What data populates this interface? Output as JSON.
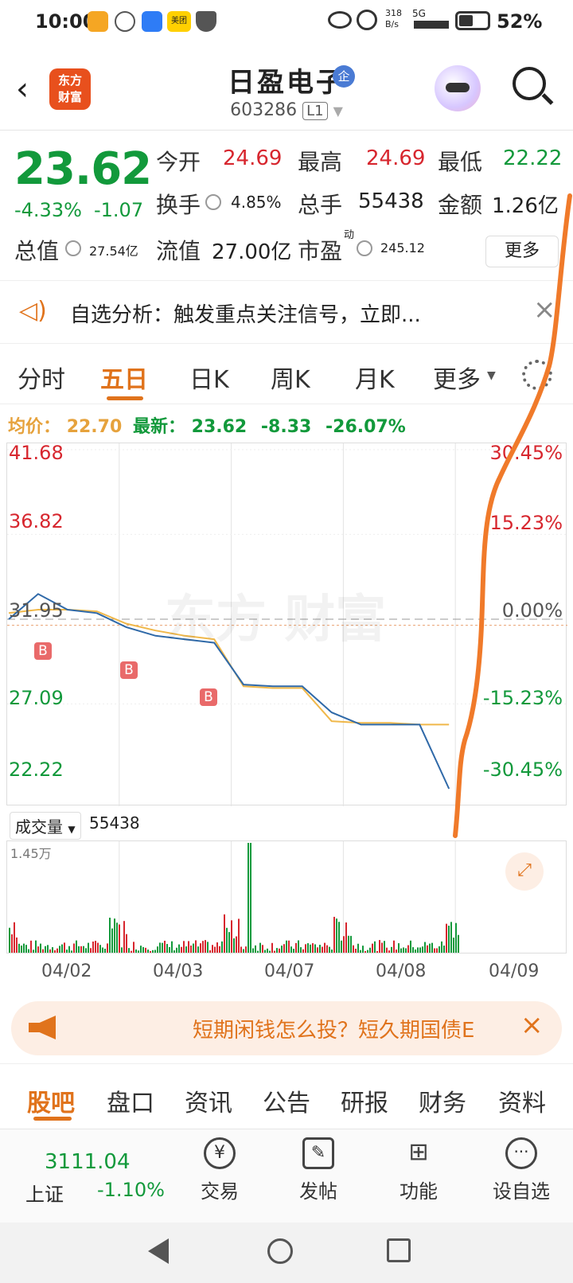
{
  "status_bar": {
    "time": "10:00",
    "speed": "318\nB/s",
    "network": "5G",
    "battery": "52%",
    "app_icon_label": "美团"
  },
  "header": {
    "logo_text": "东方\n财富",
    "title": "日盈电子",
    "badge": "企",
    "code": "603286",
    "level": "L1"
  },
  "quote": {
    "price": "23.62",
    "change_pct": "-4.33%",
    "change": "-1.07",
    "open_label": "今开",
    "open": "24.69",
    "high_label": "最高",
    "high": "24.69",
    "low_label": "最低",
    "low": "22.22",
    "turnover_label": "换手",
    "turnover": "4.85%",
    "volume_label": "总手",
    "volume": "55438",
    "amount_label": "金额",
    "amount": "1.26亿",
    "mktcap_label": "总值",
    "mktcap": "27.54亿",
    "float_label": "流值",
    "float_cap": "27.00亿",
    "pe_label": "市盈",
    "pe_sup": "动",
    "pe": "245.12",
    "more": "更多"
  },
  "notice": {
    "text": "自选分析：触发重点关注信号，立即..."
  },
  "tabs": [
    "分时",
    "五日",
    "日K",
    "周K",
    "月K",
    "更多"
  ],
  "avg_line": {
    "avg_label": "均价：",
    "avg": "22.70",
    "latest_label": "最新：",
    "latest": "23.62",
    "chg": "-8.33",
    "pct": "-26.07%"
  },
  "chart_data": {
    "type": "line",
    "title": "",
    "x": [
      "04/02",
      "04/03",
      "04/07",
      "04/08",
      "04/09"
    ],
    "y_left_ticks": [
      "41.68",
      "36.82",
      "31.95",
      "27.09",
      "22.22"
    ],
    "y_right_ticks": [
      "30.45%",
      "15.23%",
      "0.00%",
      "-15.23%",
      "-30.45%"
    ],
    "ylim": [
      22.22,
      41.68
    ],
    "series": [
      {
        "values": [
          31.95,
          33.4,
          32.5,
          32.3,
          31.5,
          31.0,
          30.8,
          30.6,
          28.2,
          28.1,
          28.1,
          26.6,
          25.9,
          25.9,
          25.9,
          22.22
        ]
      },
      {
        "values": [
          32.3,
          32.5,
          32.5,
          32.4,
          31.7,
          31.3,
          31.0,
          30.8,
          28.1,
          28.0,
          28.0,
          26.1,
          26.0,
          26.0,
          25.9,
          25.9
        ]
      }
    ],
    "buy_markers": [
      "B",
      "B",
      "B"
    ],
    "volume_label": "成交量",
    "volume_total": "55438",
    "volume_max": "1.45万"
  },
  "ad": {
    "text": "短期闲钱怎么投？短久期国债E"
  },
  "bottom_tabs": [
    "股吧",
    "盘口",
    "资讯",
    "公告",
    "研报",
    "财务",
    "资料"
  ],
  "footer": {
    "index_value": "3111.04",
    "index_name": "上证",
    "index_change": "-1.10%",
    "trade": "交易",
    "post": "发帖",
    "func": "功能",
    "watch": "设自选"
  },
  "colors": {
    "up": "#d7262e",
    "down": "#12993b",
    "accent": "#e0731c",
    "price_line": "#2f69a8",
    "avg_line": "#f0b84a"
  }
}
